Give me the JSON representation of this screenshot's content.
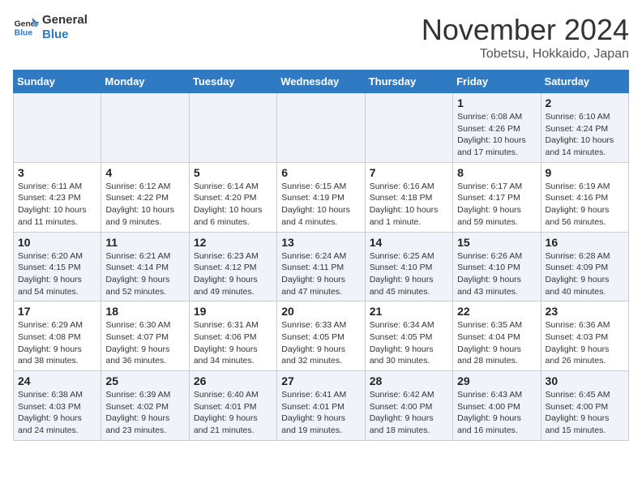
{
  "header": {
    "logo_line1": "General",
    "logo_line2": "Blue",
    "month": "November 2024",
    "location": "Tobetsu, Hokkaido, Japan"
  },
  "weekdays": [
    "Sunday",
    "Monday",
    "Tuesday",
    "Wednesday",
    "Thursday",
    "Friday",
    "Saturday"
  ],
  "weeks": [
    [
      {
        "day": "",
        "info": ""
      },
      {
        "day": "",
        "info": ""
      },
      {
        "day": "",
        "info": ""
      },
      {
        "day": "",
        "info": ""
      },
      {
        "day": "",
        "info": ""
      },
      {
        "day": "1",
        "info": "Sunrise: 6:08 AM\nSunset: 4:26 PM\nDaylight: 10 hours\nand 17 minutes."
      },
      {
        "day": "2",
        "info": "Sunrise: 6:10 AM\nSunset: 4:24 PM\nDaylight: 10 hours\nand 14 minutes."
      }
    ],
    [
      {
        "day": "3",
        "info": "Sunrise: 6:11 AM\nSunset: 4:23 PM\nDaylight: 10 hours\nand 11 minutes."
      },
      {
        "day": "4",
        "info": "Sunrise: 6:12 AM\nSunset: 4:22 PM\nDaylight: 10 hours\nand 9 minutes."
      },
      {
        "day": "5",
        "info": "Sunrise: 6:14 AM\nSunset: 4:20 PM\nDaylight: 10 hours\nand 6 minutes."
      },
      {
        "day": "6",
        "info": "Sunrise: 6:15 AM\nSunset: 4:19 PM\nDaylight: 10 hours\nand 4 minutes."
      },
      {
        "day": "7",
        "info": "Sunrise: 6:16 AM\nSunset: 4:18 PM\nDaylight: 10 hours\nand 1 minute."
      },
      {
        "day": "8",
        "info": "Sunrise: 6:17 AM\nSunset: 4:17 PM\nDaylight: 9 hours\nand 59 minutes."
      },
      {
        "day": "9",
        "info": "Sunrise: 6:19 AM\nSunset: 4:16 PM\nDaylight: 9 hours\nand 56 minutes."
      }
    ],
    [
      {
        "day": "10",
        "info": "Sunrise: 6:20 AM\nSunset: 4:15 PM\nDaylight: 9 hours\nand 54 minutes."
      },
      {
        "day": "11",
        "info": "Sunrise: 6:21 AM\nSunset: 4:14 PM\nDaylight: 9 hours\nand 52 minutes."
      },
      {
        "day": "12",
        "info": "Sunrise: 6:23 AM\nSunset: 4:12 PM\nDaylight: 9 hours\nand 49 minutes."
      },
      {
        "day": "13",
        "info": "Sunrise: 6:24 AM\nSunset: 4:11 PM\nDaylight: 9 hours\nand 47 minutes."
      },
      {
        "day": "14",
        "info": "Sunrise: 6:25 AM\nSunset: 4:10 PM\nDaylight: 9 hours\nand 45 minutes."
      },
      {
        "day": "15",
        "info": "Sunrise: 6:26 AM\nSunset: 4:10 PM\nDaylight: 9 hours\nand 43 minutes."
      },
      {
        "day": "16",
        "info": "Sunrise: 6:28 AM\nSunset: 4:09 PM\nDaylight: 9 hours\nand 40 minutes."
      }
    ],
    [
      {
        "day": "17",
        "info": "Sunrise: 6:29 AM\nSunset: 4:08 PM\nDaylight: 9 hours\nand 38 minutes."
      },
      {
        "day": "18",
        "info": "Sunrise: 6:30 AM\nSunset: 4:07 PM\nDaylight: 9 hours\nand 36 minutes."
      },
      {
        "day": "19",
        "info": "Sunrise: 6:31 AM\nSunset: 4:06 PM\nDaylight: 9 hours\nand 34 minutes."
      },
      {
        "day": "20",
        "info": "Sunrise: 6:33 AM\nSunset: 4:05 PM\nDaylight: 9 hours\nand 32 minutes."
      },
      {
        "day": "21",
        "info": "Sunrise: 6:34 AM\nSunset: 4:05 PM\nDaylight: 9 hours\nand 30 minutes."
      },
      {
        "day": "22",
        "info": "Sunrise: 6:35 AM\nSunset: 4:04 PM\nDaylight: 9 hours\nand 28 minutes."
      },
      {
        "day": "23",
        "info": "Sunrise: 6:36 AM\nSunset: 4:03 PM\nDaylight: 9 hours\nand 26 minutes."
      }
    ],
    [
      {
        "day": "24",
        "info": "Sunrise: 6:38 AM\nSunset: 4:03 PM\nDaylight: 9 hours\nand 24 minutes."
      },
      {
        "day": "25",
        "info": "Sunrise: 6:39 AM\nSunset: 4:02 PM\nDaylight: 9 hours\nand 23 minutes."
      },
      {
        "day": "26",
        "info": "Sunrise: 6:40 AM\nSunset: 4:01 PM\nDaylight: 9 hours\nand 21 minutes."
      },
      {
        "day": "27",
        "info": "Sunrise: 6:41 AM\nSunset: 4:01 PM\nDaylight: 9 hours\nand 19 minutes."
      },
      {
        "day": "28",
        "info": "Sunrise: 6:42 AM\nSunset: 4:00 PM\nDaylight: 9 hours\nand 18 minutes."
      },
      {
        "day": "29",
        "info": "Sunrise: 6:43 AM\nSunset: 4:00 PM\nDaylight: 9 hours\nand 16 minutes."
      },
      {
        "day": "30",
        "info": "Sunrise: 6:45 AM\nSunset: 4:00 PM\nDaylight: 9 hours\nand 15 minutes."
      }
    ]
  ]
}
